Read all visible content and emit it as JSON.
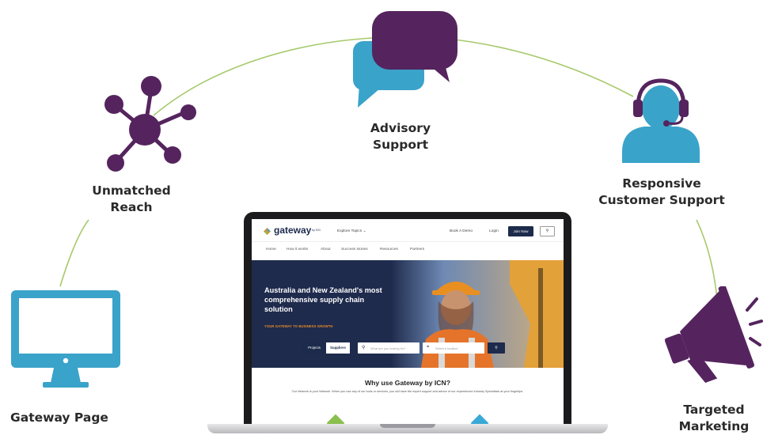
{
  "features": {
    "gateway_page": "Gateway Page",
    "unmatched_reach": [
      "Unmatched",
      "Reach"
    ],
    "advisory_support": [
      "Advisory",
      "Support"
    ],
    "customer_support": [
      "Responsive",
      "Customer Support"
    ],
    "targeted_marketing": [
      "Targeted",
      "Marketing"
    ]
  },
  "icons": {
    "monitor": "monitor-icon",
    "network": "network-icon",
    "chat": "chat-bubbles-icon",
    "headset": "headset-agent-icon",
    "megaphone": "megaphone-icon"
  },
  "colors": {
    "purple": "#55245e",
    "blue": "#3aa3c9",
    "arc_green": "#a6c96a",
    "navy": "#1c2a4b",
    "orange": "#e58a2a"
  },
  "website": {
    "logo": "gateway",
    "logo_suffix": "by ICN",
    "explore": "Explore Topics  ⌄",
    "book_demo": "Book A Demo",
    "login": "Login",
    "join_now": "Join Now",
    "menu": [
      "Home",
      "How it works",
      "About",
      "Success stories",
      "Resources",
      "Partners"
    ],
    "hero_title": "Australia and New Zealand's most comprehensive supply chain solution",
    "hero_tagline": "YOUR GATEWAY TO BUSINESS GROWTH",
    "tab_projects": "Projects",
    "tab_suppliers": "Suppliers",
    "search_what_placeholder": "What are you looking for?",
    "search_where_placeholder": "Select a location",
    "why_title": "Why use Gateway by ICN?",
    "why_body": "Our Network is your Network. When you use any of our tools or services, you will have the expert support and advice of our experienced Industry Specialists at your fingertips."
  }
}
